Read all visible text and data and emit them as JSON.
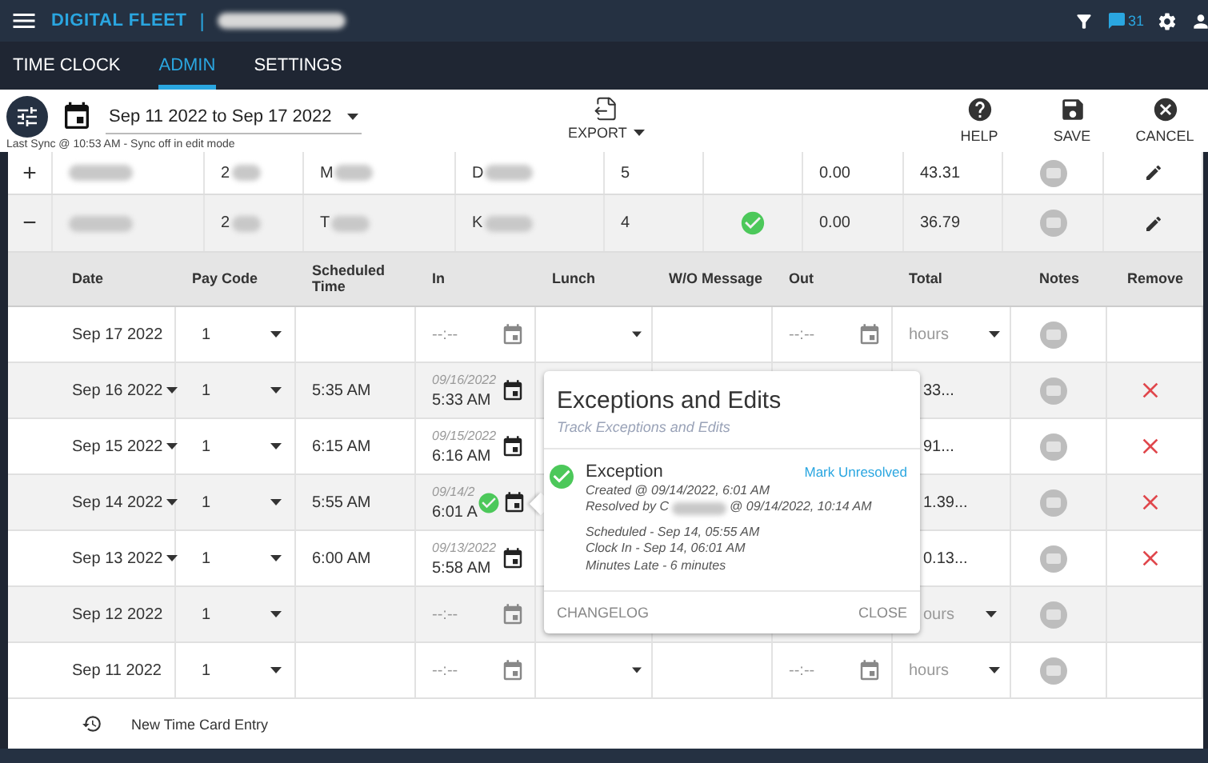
{
  "header": {
    "logo": "DIGITAL FLEET",
    "separator": "|",
    "message_count": "31"
  },
  "tabs": [
    {
      "label": "TIME CLOCK",
      "selected": false
    },
    {
      "label": "ADMIN",
      "selected": true
    },
    {
      "label": "SETTINGS",
      "selected": false
    }
  ],
  "toolbar": {
    "date_range": "Sep 11 2022 to Sep 17 2022",
    "sync_note": "Last Sync @ 10:53 AM - Sync off in edit mode",
    "export": "EXPORT",
    "actions": [
      {
        "kind": "help",
        "label": "HELP"
      },
      {
        "kind": "save",
        "label": "SAVE"
      },
      {
        "kind": "cancel",
        "label": "CANCEL"
      }
    ]
  },
  "employees": [
    {
      "toggle": "+",
      "expanded": false,
      "column_2": "2",
      "column_3": "M",
      "column_4": "D",
      "column_5": "5",
      "approved": false,
      "column_7": "0.00",
      "column_8": "43.31"
    },
    {
      "toggle": "−",
      "expanded": true,
      "column_2": "2",
      "column_3": "T",
      "column_4": "K",
      "column_5": "4",
      "approved": true,
      "column_7": "0.00",
      "column_8": "36.79"
    }
  ],
  "detail": {
    "columns": [
      "Date",
      "Pay Code",
      "Scheduled Time",
      "In",
      "Lunch",
      "W/O Message",
      "Out",
      "Total",
      "Notes",
      "Remove"
    ],
    "rows": [
      {
        "date": "Sep 17 2022",
        "date_menu": false,
        "pay_code": "1",
        "in_placeholder": "--:--",
        "out_placeholder": "--:--",
        "total": {
          "kind": "select",
          "placeholder": "hours"
        },
        "removable": false
      },
      {
        "date": "Sep 16 2022",
        "date_menu": true,
        "pay_code": "1",
        "scheduled": "5:35 AM",
        "in_date": "09/16/2022",
        "in_time": "5:33 AM",
        "total": {
          "kind": "text",
          "value": "33..."
        },
        "removable": true
      },
      {
        "date": "Sep 15 2022",
        "date_menu": true,
        "pay_code": "1",
        "scheduled": "6:15 AM",
        "in_date": "09/15/2022",
        "in_time": "6:16 AM",
        "total": {
          "kind": "text",
          "value": "91..."
        },
        "removable": true
      },
      {
        "date": "Sep 14 2022",
        "date_menu": true,
        "pay_code": "1",
        "scheduled": "5:55 AM",
        "in_date": "09/14/2",
        "in_time": "6:01 A",
        "in_approved": true,
        "total": {
          "kind": "text",
          "value": "1.39..."
        },
        "removable": true
      },
      {
        "date": "Sep 13 2022",
        "date_menu": true,
        "pay_code": "1",
        "scheduled": "6:00 AM",
        "in_date": "09/13/2022",
        "in_time": "5:58 AM",
        "total": {
          "kind": "text",
          "value": "0.13..."
        },
        "removable": true
      },
      {
        "date": "Sep 12 2022",
        "date_menu": false,
        "pay_code": "1",
        "in_placeholder": "--:--",
        "total": {
          "kind": "select",
          "placeholder": "ours"
        },
        "removable": false
      },
      {
        "date": "Sep 11 2022",
        "date_menu": false,
        "pay_code": "1",
        "in_placeholder": "--:--",
        "out_placeholder": "--:--",
        "total": {
          "kind": "select",
          "placeholder": "hours"
        },
        "removable": false
      }
    ]
  },
  "new_entry": "New Time Card Entry",
  "popover": {
    "title": "Exceptions and Edits",
    "subtitle": "Track Exceptions and Edits",
    "entry": {
      "resolved": true,
      "type": "Exception",
      "action": "Mark Unresolved",
      "created": "Created @ 09/14/2022, 6:01 AM",
      "resolved_by": "Resolved by C",
      "resolved_at": "@ 09/14/2022, 10:14 AM",
      "details": [
        "Scheduled - Sep 14, 05:55 AM",
        "Clock In - Sep 14, 06:01 AM",
        "Minutes Late - 6 minutes"
      ]
    },
    "buttons": [
      "CHANGELOG",
      "CLOSE"
    ]
  }
}
